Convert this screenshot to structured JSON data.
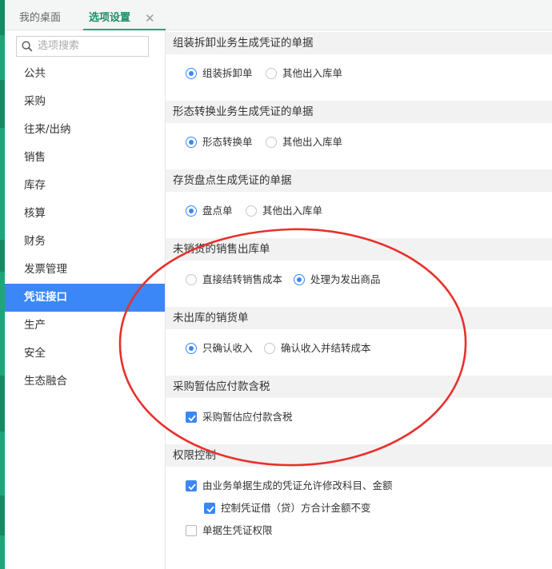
{
  "tabs": [
    {
      "label": "我的桌面"
    },
    {
      "label": "选项设置"
    }
  ],
  "search": {
    "placeholder": "选项搜索"
  },
  "sidebar": {
    "items": [
      "公共",
      "采购",
      "往来/出纳",
      "销售",
      "库存",
      "核算",
      "财务",
      "发票管理",
      "凭证接口",
      "生产",
      "安全",
      "生态融合"
    ],
    "active_item": "凭证接口"
  },
  "sections": [
    {
      "title": "组装拆卸业务生成凭证的单据",
      "options": [
        "组装拆卸单",
        "其他出入库单"
      ],
      "selected": "组装拆卸单"
    },
    {
      "title": "形态转换业务生成凭证的单据",
      "options": [
        "形态转换单",
        "其他出入库单"
      ],
      "selected": "形态转换单"
    },
    {
      "title": "存货盘点生成凭证的单据",
      "options": [
        "盘点单",
        "其他出入库单"
      ],
      "selected": "盘点单"
    },
    {
      "title": "未销货的销售出库单",
      "options": [
        "直接结转销售成本",
        "处理为发出商品"
      ],
      "selected": "处理为发出商品"
    },
    {
      "title": "未出库的销货单",
      "options": [
        "只确认收入",
        "确认收入并结转成本"
      ],
      "selected": "只确认收入"
    },
    {
      "title": "采购暂估应付款含税",
      "options": [
        "采购暂估应付款含税"
      ],
      "checked": [
        true
      ]
    },
    {
      "title": "权限控制",
      "options": [
        "由业务单据生成的凭证允许修改科目、金额",
        "控制凭证借（贷）方合计金额不变",
        "单据生凭证权限"
      ],
      "checked": [
        true,
        true,
        false
      ]
    }
  ],
  "colors": {
    "accent_blue": "#3b87f7",
    "tab_green": "#1fa57a",
    "annotation_red": "#e8302c",
    "section_bg": "#f2f2f2"
  }
}
